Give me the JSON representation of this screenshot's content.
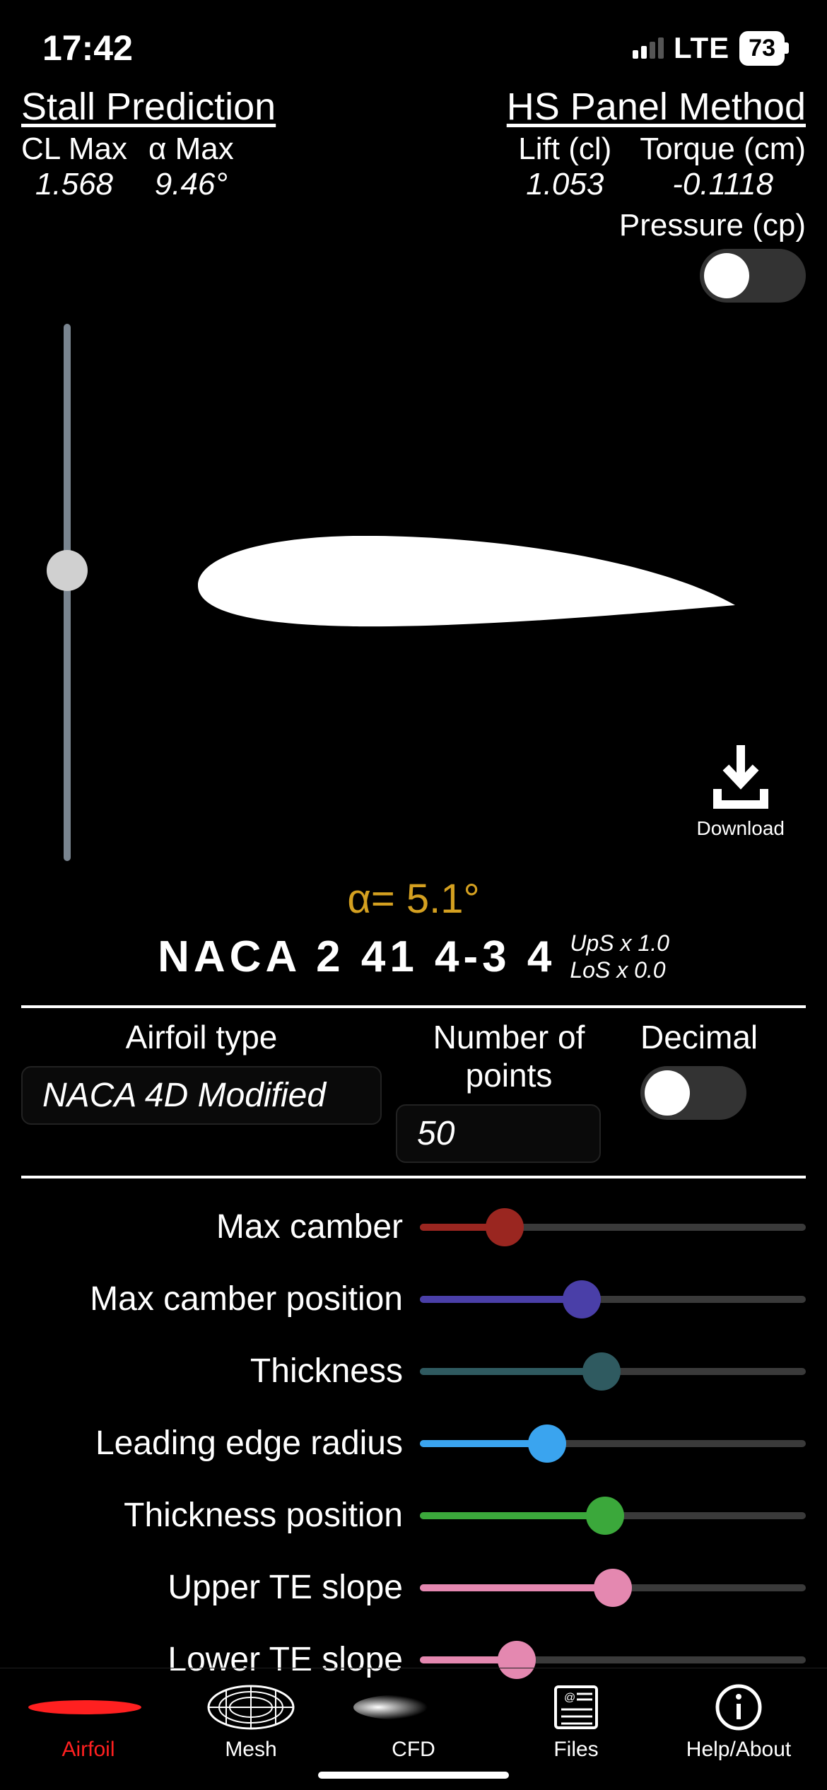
{
  "status": {
    "time": "17:42",
    "network": "LTE",
    "battery": "73"
  },
  "stall": {
    "title": "Stall Prediction",
    "cl_max_label": "CL Max",
    "cl_max_value": "1.568",
    "a_max_label": "α Max",
    "a_max_value": "9.46°"
  },
  "hs": {
    "title": "HS Panel Method",
    "lift_label": "Lift (cl)",
    "lift_value": "1.053",
    "torque_label": "Torque (cm)",
    "torque_value": "-0.1118",
    "pressure_label": "Pressure (cp)",
    "pressure_on": false
  },
  "alpha": "α= 5.1°",
  "naca": {
    "name": "NACA 2 41 4-3 4",
    "ups": "UpS x 1.0",
    "los": "LoS x 0.0"
  },
  "download_label": "Download",
  "settings": {
    "airfoil_type_label": "Airfoil type",
    "airfoil_type_value": "NACA 4D Modified",
    "npoints_label": "Number of points",
    "npoints_value": "50",
    "decimal_label": "Decimal",
    "decimal_on": false
  },
  "sliders": [
    {
      "label": "Max camber",
      "color": "#9a2620",
      "pct": 22
    },
    {
      "label": "Max camber position",
      "color": "#4a3fa8",
      "pct": 42
    },
    {
      "label": "Thickness",
      "color": "#2f5a60",
      "pct": 47
    },
    {
      "label": "Leading edge radius",
      "color": "#3aa4ef",
      "pct": 33
    },
    {
      "label": "Thickness position",
      "color": "#3ba83b",
      "pct": 48
    },
    {
      "label": "Upper TE slope",
      "color": "#e488b0",
      "pct": 50
    },
    {
      "label": "Lower TE slope",
      "color": "#e488b0",
      "pct": 25
    }
  ],
  "tabs": [
    {
      "label": "Airfoil",
      "active": true
    },
    {
      "label": "Mesh",
      "active": false
    },
    {
      "label": "CFD",
      "active": false
    },
    {
      "label": "Files",
      "active": false
    },
    {
      "label": "Help/About",
      "active": false
    }
  ]
}
